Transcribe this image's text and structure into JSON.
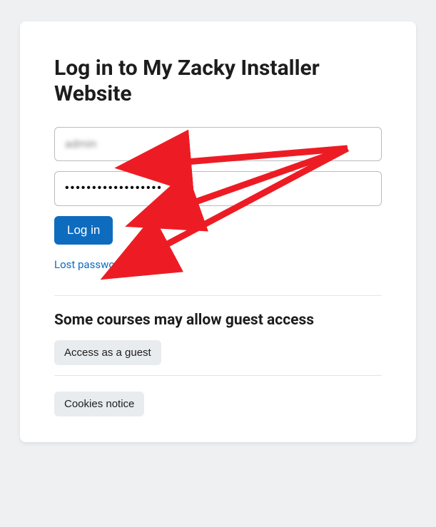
{
  "title": "Log in to My Zacky Installer Website",
  "form": {
    "username_value": "admin",
    "password_dots": "••••••••••••••••••",
    "login_button": "Log in",
    "lost_password_link": "Lost password?"
  },
  "guest": {
    "heading": "Some courses may allow guest access",
    "button": "Access as a guest"
  },
  "cookies": {
    "button": "Cookies notice"
  },
  "colors": {
    "primary": "#0e6cbf",
    "background": "#eef0f2",
    "arrow": "#ed1c24"
  }
}
